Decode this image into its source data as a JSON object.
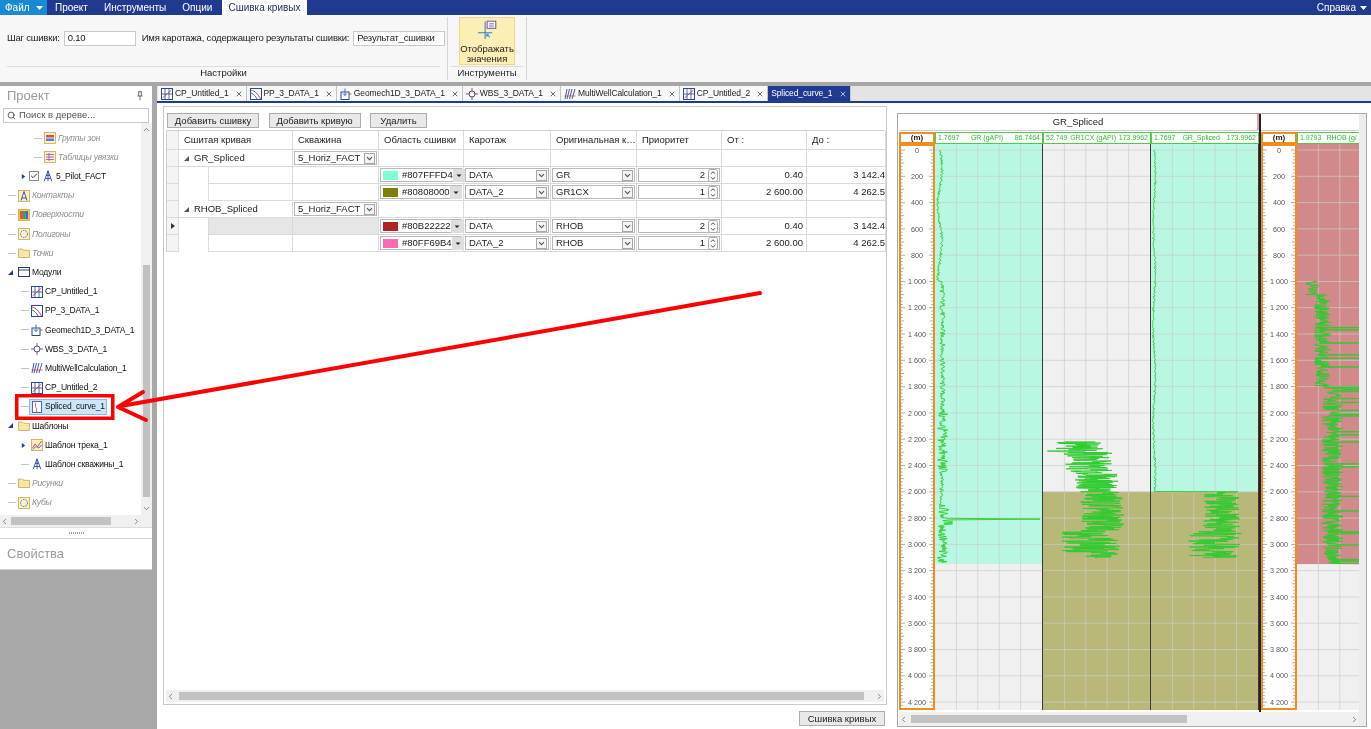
{
  "menu_bar": {
    "file_menu": {
      "label": "Файл"
    },
    "tabs": [
      {
        "label": "Проект",
        "selected": false
      },
      {
        "label": "Инструменты",
        "selected": false
      },
      {
        "label": "Опции",
        "selected": false
      },
      {
        "label": "Сшивка кривых",
        "selected": true
      }
    ],
    "help_menu": {
      "label": "Справка"
    }
  },
  "ribbon": {
    "groups": [
      {
        "kind": "fields",
        "caption": "Настройки",
        "fields": [
          {
            "label": "Шаг сшивки:",
            "value": "0.10"
          },
          {
            "label": "Имя каротажа, содержащего результаты сшивки:",
            "value": "Результат_сшивки"
          }
        ]
      },
      {
        "kind": "buttons",
        "caption": "Инструменты",
        "buttons": [
          {
            "label": "Отображать значения",
            "on": true
          }
        ]
      }
    ]
  },
  "project_panel": {
    "title": "Проект",
    "search": {
      "placeholder": "Поиск в дереве..."
    },
    "tree": [
      {
        "children": [
          {
            "children": [
              {
                "label": "Группы зон",
                "kind": "zones",
                "disabled": true,
                "selected": false
              },
              {
                "label": "Таблицы увязки",
                "kind": "table",
                "disabled": true,
                "selected": false
              }
            ]
          },
          {
            "label": "5_Pilot_FACT",
            "kind": "well",
            "checked": true,
            "expanded": false,
            "disabled": false,
            "selected": false
          }
        ]
      },
      {
        "label": "Контакты",
        "kind": "contacts",
        "disabled": true,
        "selected": false
      },
      {
        "label": "Поверхности",
        "kind": "surface",
        "disabled": true,
        "selected": false
      },
      {
        "label": "Полигоны",
        "kind": "polygons",
        "disabled": true,
        "selected": false
      },
      {
        "label": "Точки",
        "kind": "folder",
        "disabled": true,
        "selected": false
      },
      {
        "label": "Модули",
        "kind": "modules",
        "expanded": true,
        "disabled": false,
        "selected": false,
        "children": [
          {
            "label": "CP_Untitled_1",
            "kind": "crossplot",
            "disabled": false,
            "selected": false
          },
          {
            "label": "PP_3_DATA_1",
            "kind": "pressure",
            "disabled": false,
            "selected": false
          },
          {
            "label": "Geomech1D_3_DATA_1",
            "kind": "geomech",
            "disabled": false,
            "selected": false
          },
          {
            "label": "WBS_3_DATA_1",
            "kind": "wbs",
            "disabled": false,
            "selected": false
          },
          {
            "label": "MultiWellCalculation_1",
            "kind": "multiwell",
            "disabled": false,
            "selected": false
          },
          {
            "label": "CP_Untitled_2",
            "kind": "crossplot",
            "disabled": false,
            "selected": false
          },
          {
            "label": "Spliced_curve_1",
            "kind": "splice",
            "disabled": false,
            "selected": true
          }
        ]
      },
      {
        "label": "Шаблоны",
        "kind": "folder",
        "expanded": true,
        "disabled": false,
        "selected": false,
        "children": [
          {
            "label": "Шаблон трека_1",
            "kind": "track_template",
            "expanded": false,
            "disabled": false,
            "selected": false
          },
          {
            "label": "Шаблон скважины_1",
            "kind": "well",
            "disabled": false,
            "selected": false
          }
        ]
      },
      {
        "label": "Рисунки",
        "kind": "folder",
        "disabled": true,
        "selected": false
      },
      {
        "label": "Кубы",
        "kind": "polygons",
        "disabled": true,
        "selected": false
      }
    ]
  },
  "properties_panel": {
    "title": "Свойства"
  },
  "document_tabs": [
    {
      "label": "CP_Untitled_1",
      "kind": "crossplot",
      "selected": false
    },
    {
      "label": "PP_3_DATA_1",
      "kind": "pressure",
      "selected": false
    },
    {
      "label": "Geomech1D_3_DATA_1",
      "kind": "geomech",
      "selected": false
    },
    {
      "label": "WBS_3_DATA_1",
      "kind": "wbs",
      "selected": false
    },
    {
      "label": "MultiWellCalculation_1",
      "kind": "multiwell",
      "selected": false
    },
    {
      "label": "CP_Untitled_2",
      "kind": "crossplot",
      "selected": false
    },
    {
      "label": "Spliced_curve_1",
      "kind": "plain",
      "selected": true
    }
  ],
  "toolbar_buttons": [
    "Добавить сшивку",
    "Добавить кривую",
    "Удалить"
  ],
  "table": {
    "columns": [
      "Сшитая кривая",
      "Скважина",
      "Область сшивки",
      "Каротаж",
      "Оригинальная к…",
      "Приоритет",
      "От :",
      "До :"
    ],
    "groups": [
      {
        "name": "GR_Spliced",
        "well": "5_Horiz_FACT",
        "expanded": true,
        "rows": [
          {
            "color": "#7fffd4",
            "color_code": "#807FFFD4",
            "log": "DATA",
            "curve": "GR",
            "priority": "2",
            "from": "0.40",
            "to": "3 142.4",
            "current": false
          },
          {
            "color": "#808000",
            "color_code": "#80808000",
            "log": "DATA_2",
            "curve": "GR1CX",
            "priority": "1",
            "from": "2 600.00",
            "to": "4 262.5",
            "current": false
          }
        ]
      },
      {
        "name": "RHOB_Spliced",
        "well": "5_Horiz_FACT",
        "expanded": true,
        "rows": [
          {
            "color": "#b22222",
            "color_code": "#80B22222",
            "log": "DATA",
            "curve": "RHOB",
            "priority": "2",
            "from": "0.40",
            "to": "3 142.4",
            "current": true
          },
          {
            "color": "#ff69b4",
            "color_code": "#80FF69B4",
            "log": "DATA_2",
            "curve": "RHOB",
            "priority": "1",
            "from": "2 600.00",
            "to": "4 262.5",
            "current": false
          }
        ]
      }
    ]
  },
  "footer_button": "Сшивка кривых",
  "log_view": {
    "groups": [
      {
        "title": "GR_Spliced",
        "tracks": [
          {
            "kind": "depth",
            "unit": "(m)",
            "labels": [
              "0",
              "200",
              "400",
              "600",
              "800",
              "1 000",
              "1 200",
              "1 400",
              "1 600",
              "1 800",
              "2 000",
              "2 200",
              "2 400",
              "2 600",
              "2 800",
              "3 000",
              "3 200",
              "3 400",
              "3 600",
              "3 800",
              "4 000",
              "4 200"
            ]
          },
          {
            "kind": "curve",
            "min": "1.7697",
            "name": "GR (gAPI)",
            "max": "86.7464"
          },
          {
            "kind": "curve",
            "min": "52.749",
            "name": "GR1CX (gAPI)",
            "max": "173.9962"
          },
          {
            "kind": "curve",
            "min": "1.7697",
            "name": "GR_Spliced",
            "max": "173.9962"
          }
        ]
      },
      {
        "tracks": [
          {
            "kind": "depth",
            "unit": "(m)",
            "labels": [
              "0",
              "200",
              "400",
              "600",
              "800",
              "1 000",
              "1 200",
              "1 400",
              "1 600",
              "1 800",
              "2 000",
              "2 200",
              "2 400",
              "2 600",
              "2 800",
              "3 000",
              "3 200",
              "3 400",
              "3 600",
              "3 800",
              "4 000",
              "4 200"
            ]
          },
          {
            "kind": "curve",
            "min": "1.9793",
            "name": "RHOB (g/"
          }
        ]
      }
    ]
  }
}
